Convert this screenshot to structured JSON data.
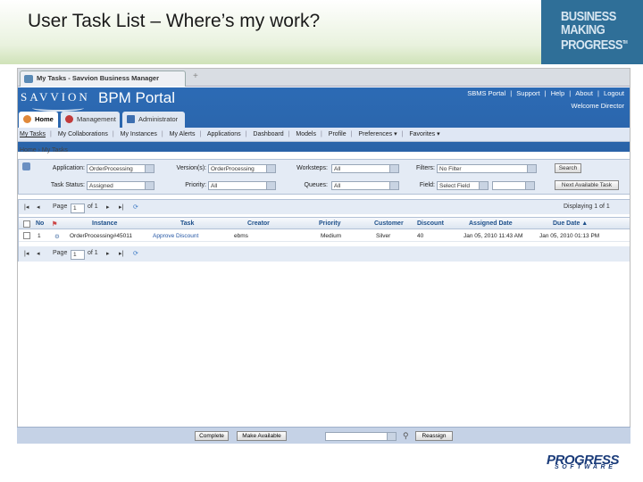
{
  "slide": {
    "title": "User Task List – Where’s my work?"
  },
  "brand": {
    "line1": "BUSINESS",
    "line2": "MAKING",
    "line3": "PROGRESS",
    "tm": "TM",
    "color": "#2f6f98"
  },
  "browser": {
    "tab_title": "My Tasks - Savvion Business Manager",
    "new_tab": "+"
  },
  "portal": {
    "logo": "SAVVION",
    "title": "BPM Portal",
    "links": [
      "SBMS Portal",
      "|",
      "Support",
      "|",
      "Help",
      "|",
      "About",
      "|",
      "Logout"
    ],
    "welcome": "Welcome Director",
    "tabs": [
      "Home",
      "Management",
      "Administrator"
    ],
    "subnav": [
      "My Tasks",
      "My Collaborations",
      "My Instances",
      "My Alerts",
      "Applications",
      "Dashboard",
      "Models",
      "Profile",
      "Preferences ▾",
      "Favorites ▾"
    ],
    "breadcrumb": "Home › My Tasks",
    "accent": "#2c6bb5"
  },
  "filters": {
    "application_label": "Application:",
    "application_value": "OrderProcessing",
    "versions_label": "Version(s):",
    "versions_value": "OrderProcessing",
    "worksteps_label": "Worksteps:",
    "worksteps_value": "All",
    "filters_label": "Filters:",
    "filters_value": "No Filter",
    "search_btn": "Search",
    "task_status_label": "Task Status:",
    "task_status_value": "Assigned",
    "priority_label": "Priority:",
    "priority_value": "All",
    "queues_label": "Queues:",
    "queues_value": "All",
    "field_label": "Field:",
    "field_value": "Select Field",
    "next_btn": "Next Available Task"
  },
  "pager": {
    "page_label": "Page",
    "page_value": "1",
    "of_label": "of 1",
    "displaying": "Displaying 1 of 1"
  },
  "table": {
    "headers": [
      "No",
      "Instance",
      "Task",
      "Creator",
      "Priority",
      "Customer",
      "Discount",
      "Assigned Date",
      "Due Date ▲"
    ],
    "rows": [
      {
        "no": "1",
        "instance": "OrderProcessing#45011",
        "task": "Approve Discount",
        "creator": "ebms",
        "priority": "Medium",
        "customer": "Silver",
        "discount": "40",
        "assigned": "Jan 05, 2010 11:43 AM",
        "due": "Jan 05, 2010 01:13 PM"
      }
    ]
  },
  "footer": {
    "buttons": [
      "Complete",
      "Make Available",
      "Reassign"
    ]
  },
  "progress": {
    "logo": "PROGRESS",
    "sub": "SOFTWARE",
    "color": "#1b3c7a"
  }
}
